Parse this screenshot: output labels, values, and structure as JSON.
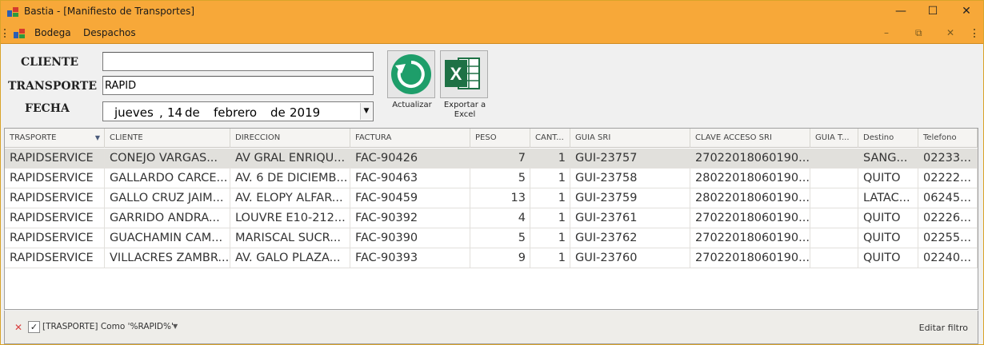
{
  "window": {
    "title": "Bastia - [Manifiesto de Transportes]",
    "controls": {
      "minimize": "—",
      "maximize": "☐",
      "close": "✕"
    }
  },
  "menu": {
    "items": [
      {
        "label": "Bodega"
      },
      {
        "label": "Despachos"
      }
    ],
    "mdi_controls": {
      "minimize": "–",
      "restore": "⧉",
      "close": "✕"
    }
  },
  "form": {
    "cliente_label": "CLIENTE",
    "cliente_value": "",
    "transporte_label": "TRANSPORTE",
    "transporte_value": "RAPID",
    "fecha_label": "FECHA",
    "fecha": {
      "weekday": "jueves",
      "sep": ",",
      "day": "14",
      "de1": "de",
      "month": "febrero",
      "de2": "de",
      "year": "2019"
    }
  },
  "buttons": {
    "actualizar_label": "Actualizar",
    "exportar_label_1": "Exportar a",
    "exportar_label_2": "Excel",
    "exportar_icon_text": "X"
  },
  "grid": {
    "columns": [
      "TRASPORTE",
      "CLIENTE",
      "DIRECCION",
      "FACTURA",
      "PESO",
      "CANT...",
      "GUIA SRI",
      "CLAVE ACCESO SRI",
      "GUIA T...",
      "Destino",
      "Telefono"
    ],
    "rows": [
      [
        "RAPIDSERVICE",
        "CONEJO VARGAS...",
        "AV GRAL ENRIQU...",
        "FAC-90426",
        "7",
        "1",
        "GUI-23757",
        "27022018060190...",
        "",
        "SANG...",
        "02233..."
      ],
      [
        "RAPIDSERVICE",
        "GALLARDO CARCE...",
        "AV. 6 DE DICIEMB...",
        "FAC-90463",
        "5",
        "1",
        "GUI-23758",
        "28022018060190...",
        "",
        "QUITO",
        "02222..."
      ],
      [
        "RAPIDSERVICE",
        "GALLO CRUZ JAIM...",
        "AV. ELOPY ALFAR...",
        "FAC-90459",
        "13",
        "1",
        "GUI-23759",
        "28022018060190...",
        "",
        "LATAC...",
        "06245..."
      ],
      [
        "RAPIDSERVICE",
        "GARRIDO ANDRA...",
        "LOUVRE E10-212...",
        "FAC-90392",
        "4",
        "1",
        "GUI-23761",
        "27022018060190...",
        "",
        "QUITO",
        "02226..."
      ],
      [
        "RAPIDSERVICE",
        "GUACHAMIN CAM...",
        "MARISCAL SUCR...",
        "FAC-90390",
        "5",
        "1",
        "GUI-23762",
        "27022018060190...",
        "",
        "QUITO",
        "02255..."
      ],
      [
        "RAPIDSERVICE",
        "VILLACRES ZAMBR...",
        "AV. GALO PLAZA...",
        "FAC-90393",
        "9",
        "1",
        "GUI-23760",
        "27022018060190...",
        "",
        "QUITO",
        "02240..."
      ]
    ],
    "selected_row": 0
  },
  "filter": {
    "text": "[TRASPORTE] Como '%RAPID%'",
    "checked_mark": "✓",
    "remove_mark": "✕",
    "edit_label": "Editar filtro"
  },
  "colors": {
    "titlebar": "#f7a839",
    "selected_row": "#e1e0dc",
    "refresh_green": "#1e9e6a",
    "excel_green": "#1e7145"
  }
}
